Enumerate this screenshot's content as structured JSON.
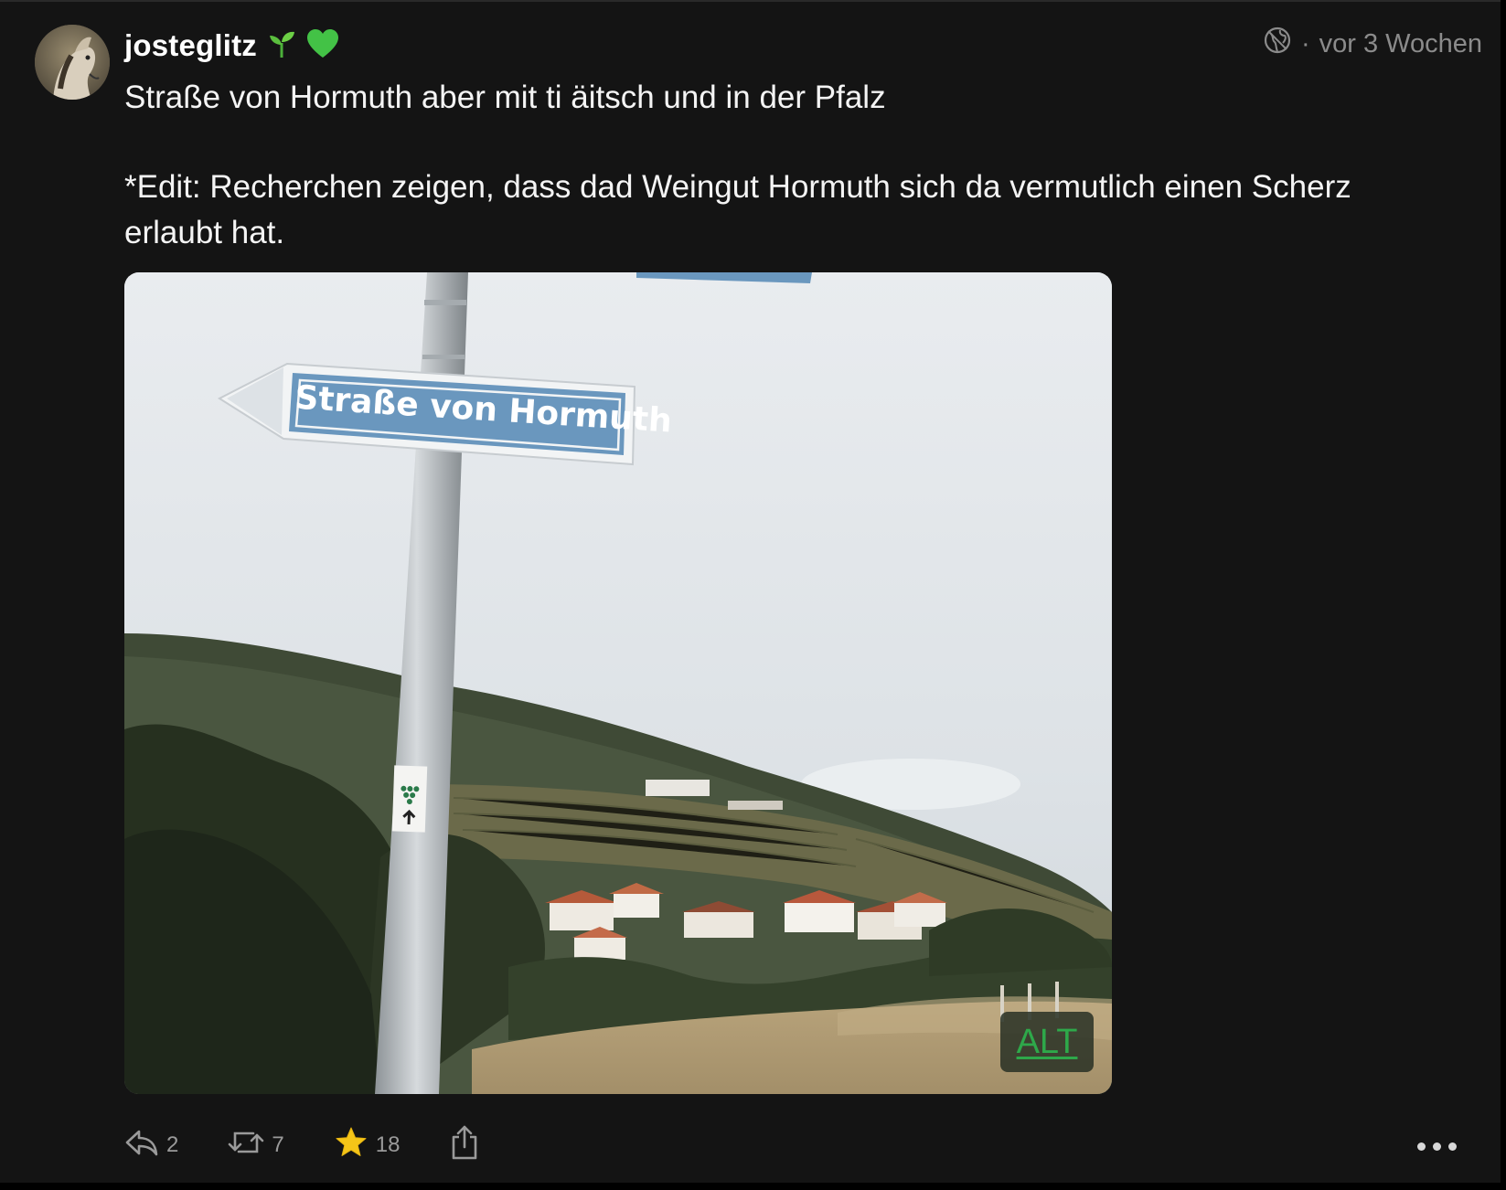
{
  "post": {
    "author": "josteglitz",
    "author_emoji": [
      "seedling-icon",
      "green-heart-icon"
    ],
    "visibility_icon": "globe-icon",
    "time_separator": "·",
    "timestamp": "vor 3 Wochen",
    "paragraphs": [
      "Straße von Hormuth aber mit ti äitsch und in der Pfalz",
      "*Edit: Recherchen zeigen, dass dad Weingut Hormuth sich da vermutlich einen Scherz erlaubt hat."
    ],
    "image": {
      "sign_text": "Straße von Hormuth",
      "alt_label": "ALT"
    },
    "actions": {
      "replies": "2",
      "boosts": "7",
      "favourites": "18"
    }
  },
  "colors": {
    "background": "#141414",
    "text": "#f4f4f4",
    "muted": "#8b8b8b",
    "star": "#f5c518",
    "alt_text": "#2ea84a",
    "sign_blue": "#6a97be"
  }
}
